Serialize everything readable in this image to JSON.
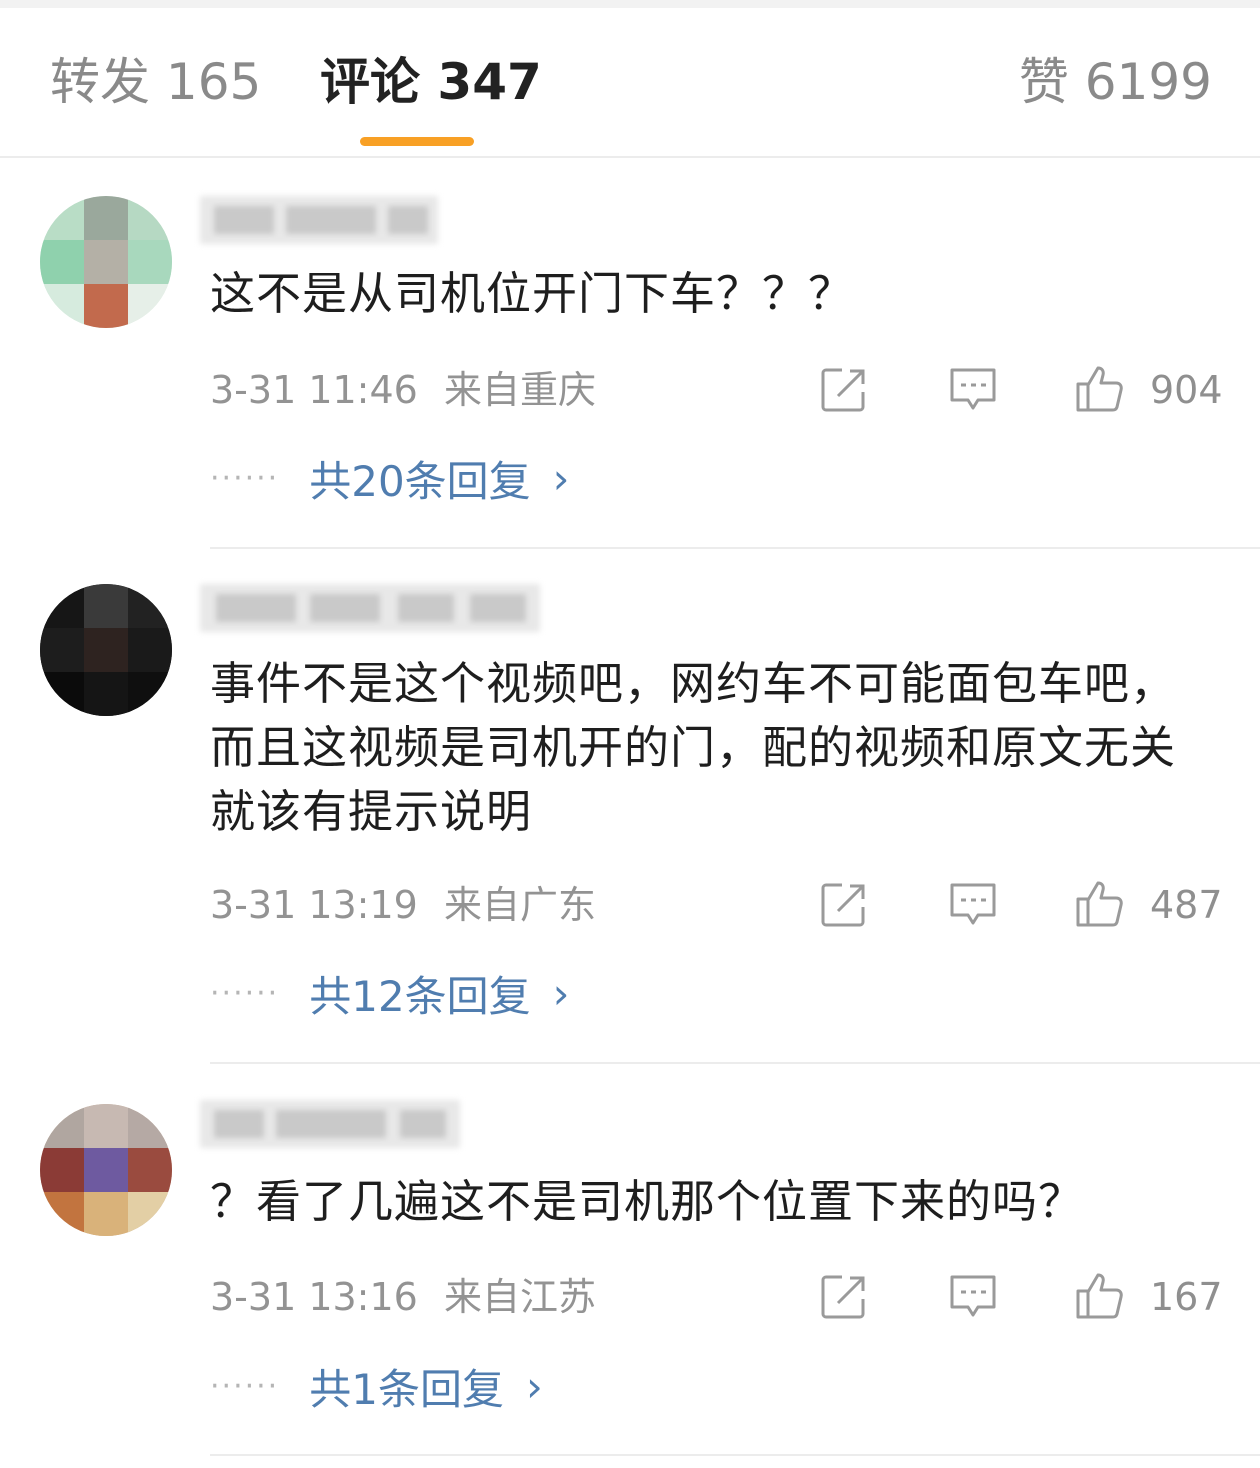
{
  "tabs": {
    "repost": "转发 165",
    "comments": "评论 347",
    "likes": "赞 6199"
  },
  "comments": [
    {
      "text": "这不是从司机位开门下车？？？",
      "time": "3-31 11:46",
      "location": "来自重庆",
      "likes": "904",
      "replies": "共20条回复"
    },
    {
      "text": "事件不是这个视频吧，网约车不可能面包车吧，而且这视频是司机开的门，配的视频和原文无关就该有提示说明",
      "time": "3-31 13:19",
      "location": "来自广东",
      "likes": "487",
      "replies": "共12条回复"
    },
    {
      "text": "？看了几遍这不是司机那个位置下来的吗？",
      "time": "3-31 13:16",
      "location": "来自江苏",
      "likes": "167",
      "replies": "共1条回复"
    }
  ],
  "icons": {
    "share": "share-icon",
    "comment": "comment-icon",
    "like": "thumbs-up-icon",
    "more": "chevron-right-icon"
  },
  "colors": {
    "accent": "#f8a025",
    "link": "#507daf",
    "muted": "#939393"
  }
}
